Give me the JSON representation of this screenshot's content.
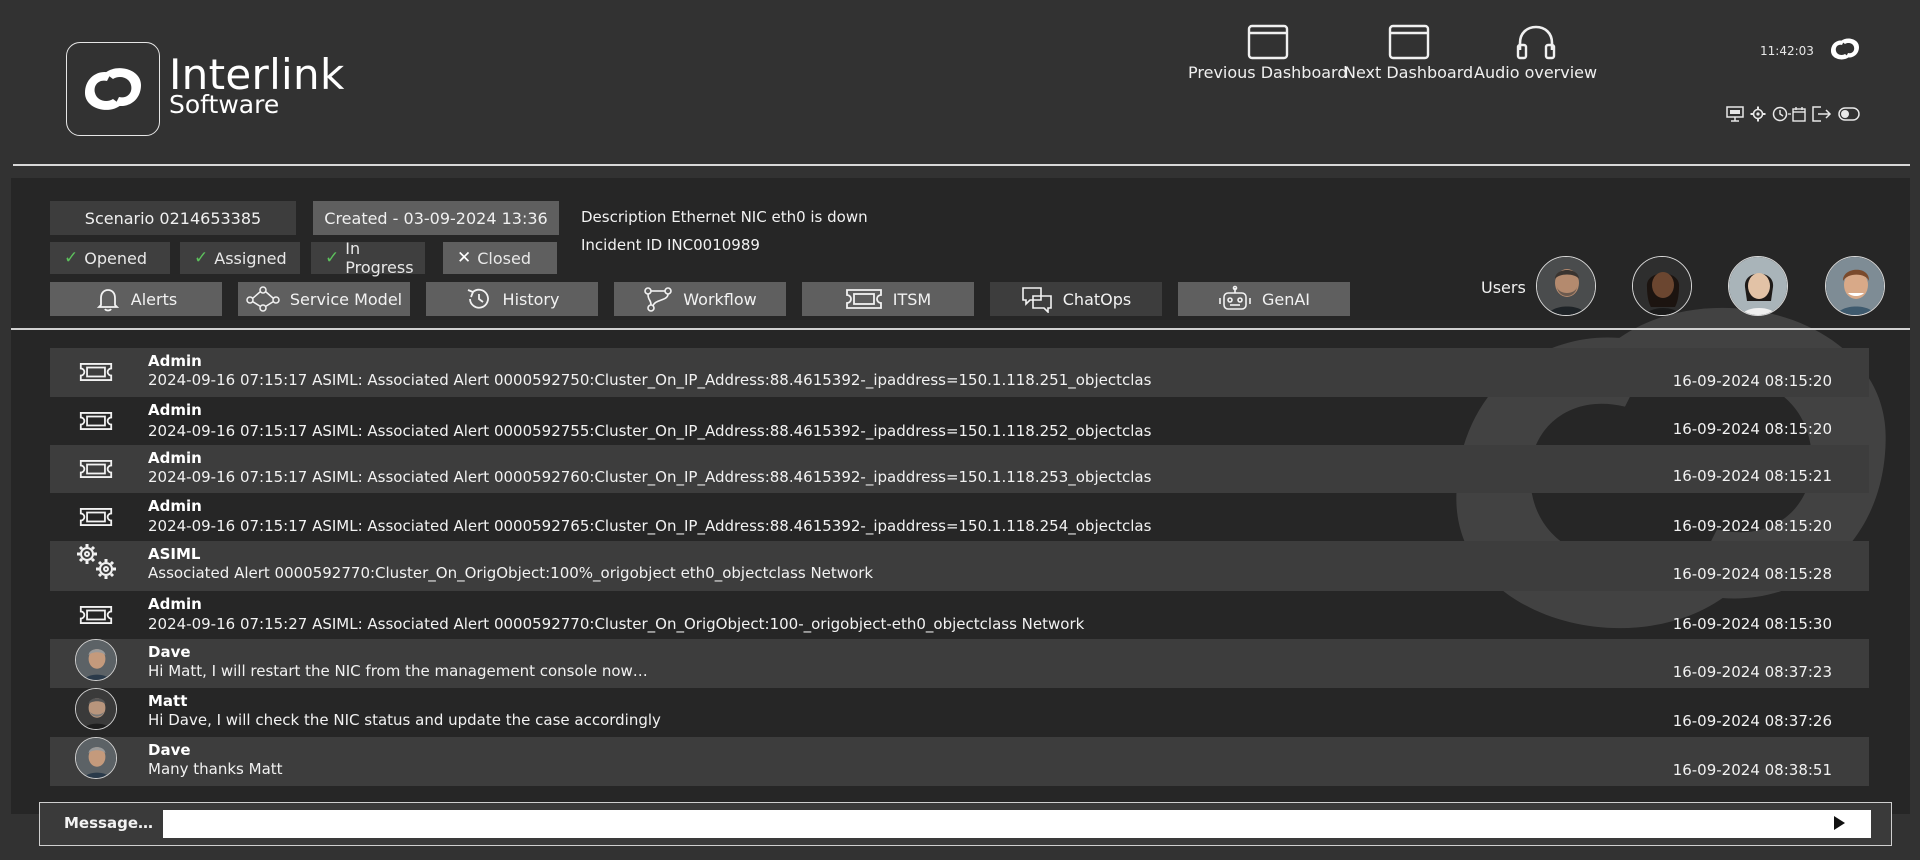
{
  "header": {
    "logo_line1": "Interlink",
    "logo_line2": "Software",
    "nav": [
      {
        "label": "Previous Dashboard",
        "icon": "window-icon"
      },
      {
        "label": "Next Dashboard",
        "icon": "window-icon"
      },
      {
        "label": "Audio overview",
        "icon": "headphones-icon"
      }
    ],
    "clock": "11:42:03",
    "tool_icons": [
      "display-icon",
      "gear-icon",
      "clock-calendar-icon",
      "logout-icon",
      "toggle-icon"
    ]
  },
  "incident": {
    "scenario": "Scenario 0214653385",
    "created": "Created - 03-09-2024 13:36",
    "description": "Description Ethernet NIC eth0 is down",
    "incident_id": "Incident ID INC0010989",
    "statuses": [
      {
        "label": "Opened",
        "state": "check"
      },
      {
        "label": "Assigned",
        "state": "check"
      },
      {
        "label": "In Progress",
        "state": "check"
      },
      {
        "label": "Closed",
        "state": "x"
      }
    ]
  },
  "tabs": [
    {
      "label": "Alerts",
      "icon": "bell-icon"
    },
    {
      "label": "Service Model",
      "icon": "network-icon"
    },
    {
      "label": "History",
      "icon": "history-icon"
    },
    {
      "label": "Workflow",
      "icon": "workflow-icon"
    },
    {
      "label": "ITSM",
      "icon": "ticket-icon"
    },
    {
      "label": "ChatOps",
      "icon": "chat-icon"
    },
    {
      "label": "GenAI",
      "icon": "robot-icon"
    }
  ],
  "users": {
    "label": "Users",
    "avatars": [
      "user-avatar-1",
      "user-avatar-2",
      "user-avatar-3",
      "user-avatar-4"
    ]
  },
  "log": [
    {
      "who": "Admin",
      "msg": "2024-09-16 07:15:17 ASIML: Associated Alert 0000592750:Cluster_On_IP_Address:88.4615392-_ipaddress=150.1.118.251_objectclas",
      "ts": "16-09-2024 08:15:20",
      "icon": "ticket-icon"
    },
    {
      "who": "Admin",
      "msg": "2024-09-16 07:15:17 ASIML: Associated Alert 0000592755:Cluster_On_IP_Address:88.4615392-_ipaddress=150.1.118.252_objectclas",
      "ts": "16-09-2024 08:15:20",
      "icon": "ticket-icon"
    },
    {
      "who": "Admin",
      "msg": "2024-09-16 07:15:17 ASIML: Associated Alert 0000592760:Cluster_On_IP_Address:88.4615392-_ipaddress=150.1.118.253_objectclas",
      "ts": "16-09-2024 08:15:21",
      "icon": "ticket-icon"
    },
    {
      "who": "Admin",
      "msg": "2024-09-16 07:15:17 ASIML: Associated Alert 0000592765:Cluster_On_IP_Address:88.4615392-_ipaddress=150.1.118.254_objectclas",
      "ts": "16-09-2024 08:15:20",
      "icon": "ticket-icon"
    },
    {
      "who": "ASIML",
      "msg": "Associated Alert 0000592770:Cluster_On_OrigObject:100%_origobject eth0_objectclass Network",
      "ts": "16-09-2024 08:15:28",
      "icon": "gears-icon"
    },
    {
      "who": "Admin",
      "msg": "2024-09-16 07:15:27 ASIML: Associated Alert 0000592770:Cluster_On_OrigObject:100-_origobject-eth0_objectclass Network",
      "ts": "16-09-2024 08:15:30",
      "icon": "ticket-icon"
    },
    {
      "who": "Dave",
      "msg": "Hi Matt, I will restart the NIC from the management console now…",
      "ts": "16-09-2024 08:37:23",
      "icon": "avatar-dave"
    },
    {
      "who": "Matt",
      "msg": "Hi Dave, I will check the NIC status and update the case accordingly",
      "ts": "16-09-2024 08:37:26",
      "icon": "avatar-matt"
    },
    {
      "who": "Dave",
      "msg": "Many thanks Matt",
      "ts": "16-09-2024 08:38:51",
      "icon": "avatar-dave"
    }
  ],
  "message_bar": {
    "label": "Message…",
    "value": ""
  },
  "colors": {
    "background": "#323232",
    "panel": "#262626",
    "row_stripe": "#3d3d3d",
    "chip_light": "#5f5f5f",
    "check_green": "#5cc15c"
  }
}
